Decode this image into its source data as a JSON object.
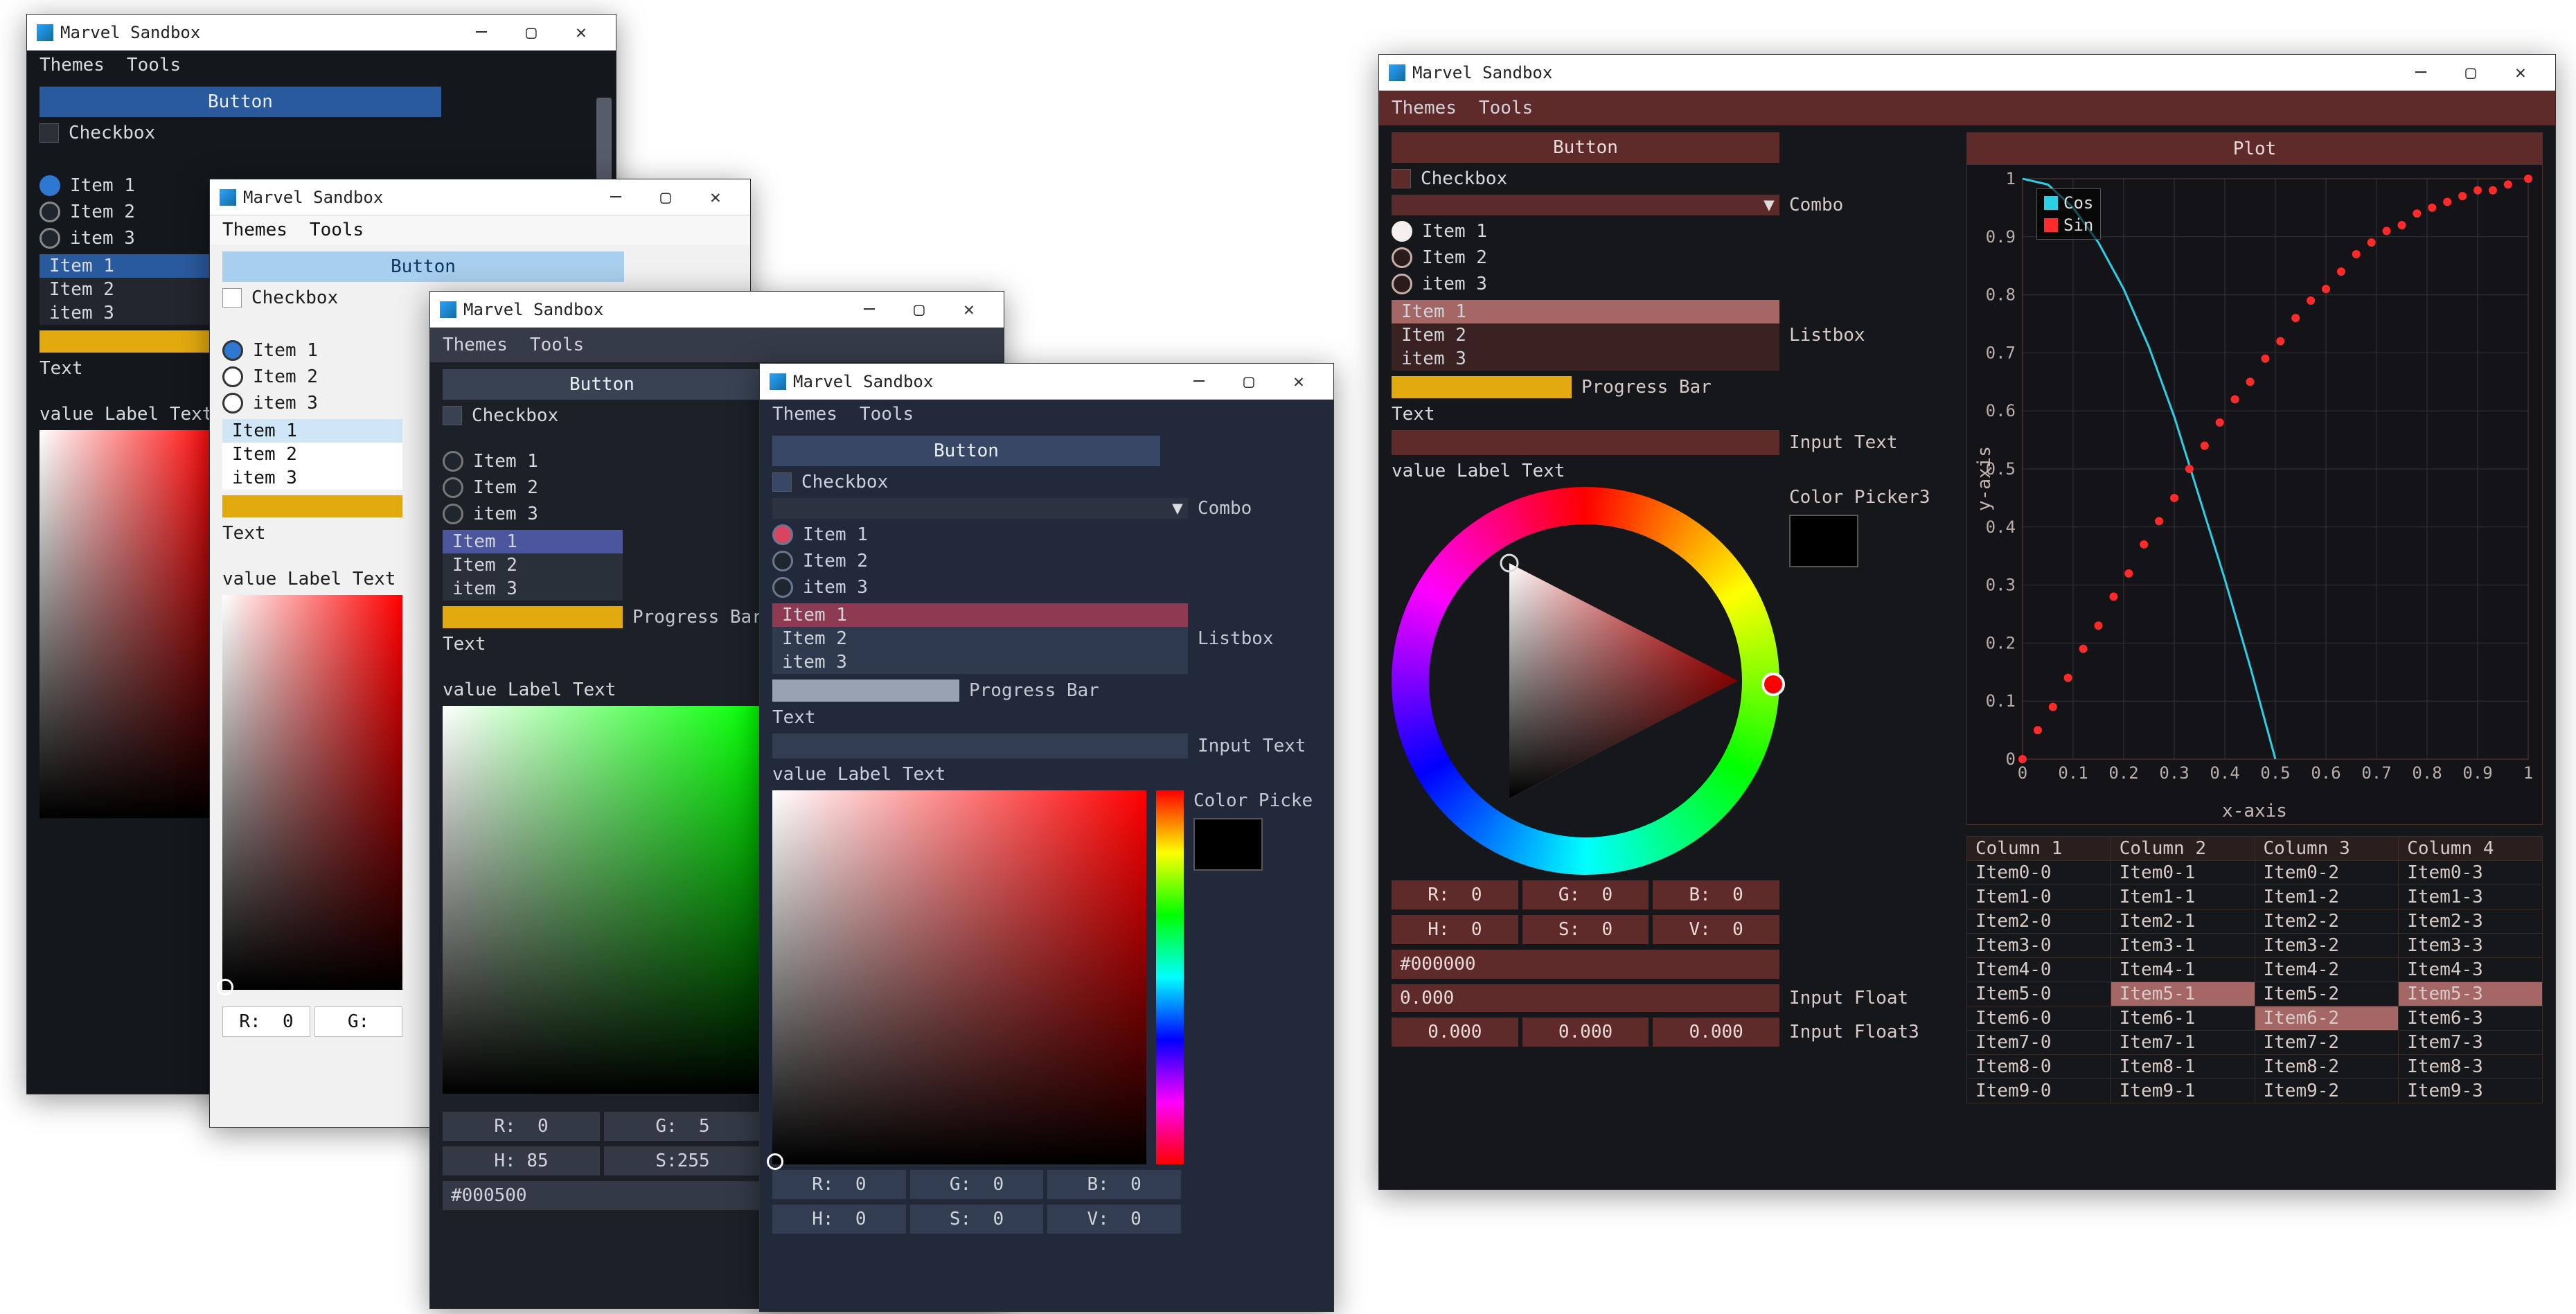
{
  "app_title": "Marvel Sandbox",
  "menus": {
    "themes": "Themes",
    "tools": "Tools"
  },
  "widgets": {
    "button": "Button",
    "checkbox": "Checkbox",
    "radio": [
      "Item 1",
      "Item 2",
      "item 3"
    ],
    "list": [
      "Item 1",
      "Item 2",
      "item 3"
    ],
    "listbox_label": "Listbox",
    "combo_label": "Combo",
    "progress_label": "Progress Bar",
    "progress_value": 0.5,
    "text": "Text",
    "input_text_label": "Input Text",
    "value_label_text": "value Label Text",
    "color_picker3_label": "Color Picker3",
    "color_picker_label": "Color Picke",
    "hex": "#000000",
    "input_float_label": "Input Float",
    "input_float_value": "0.000",
    "input_float3_label": "Input Float3",
    "input_float3_values": [
      "0.000",
      "0.000",
      "0.000"
    ]
  },
  "rgb_labels": {
    "r": "R:",
    "g": "G:",
    "b": "B:",
    "h": "H:",
    "s": "S:",
    "v": "V:"
  },
  "window_a": {
    "rgb": {
      "r": 0,
      "g": null,
      "b": null
    },
    "hsv": {
      "h": null,
      "s": null,
      "v": null
    }
  },
  "window_b": {
    "hex": "#000500",
    "rgb": {
      "r": 0,
      "g": 5,
      "b": null
    },
    "hsv": {
      "h": 85,
      "s": 255,
      "v": null
    }
  },
  "window_c": {
    "rgb": {
      "r": 0,
      "g": 0,
      "b": 0
    },
    "hsv": {
      "h": 0,
      "s": 0,
      "v": 0
    }
  },
  "window_d": {
    "rgb": {
      "r": 0,
      "g": 0,
      "b": 0
    },
    "hsv": {
      "h": 0,
      "s": 0,
      "v": 0
    }
  },
  "chart_data": {
    "type": "line",
    "title": "Plot",
    "xlabel": "x-axis",
    "ylabel": "y-axis",
    "xlim": [
      0,
      1
    ],
    "ylim": [
      0,
      1
    ],
    "xticks": [
      0,
      0.1,
      0.2,
      0.3,
      0.4,
      0.5,
      0.6,
      0.7,
      0.8,
      0.9,
      1
    ],
    "yticks": [
      0,
      0.1,
      0.2,
      0.3,
      0.4,
      0.5,
      0.6,
      0.7,
      0.8,
      0.9,
      1
    ],
    "legend_pos": "upper-left",
    "series": [
      {
        "name": "Cos",
        "color": "#2bd0e6",
        "style": "line",
        "x": [
          0,
          0.05,
          0.1,
          0.15,
          0.2,
          0.25,
          0.3,
          0.35,
          0.4,
          0.45,
          0.5
        ],
        "y": [
          1.0,
          0.99,
          0.95,
          0.89,
          0.81,
          0.71,
          0.59,
          0.45,
          0.31,
          0.16,
          0.0
        ]
      },
      {
        "name": "Sin",
        "color": "#ff2a2a",
        "style": "dots",
        "x": [
          0,
          0.03,
          0.06,
          0.09,
          0.12,
          0.15,
          0.18,
          0.21,
          0.24,
          0.27,
          0.3,
          0.33,
          0.36,
          0.39,
          0.42,
          0.45,
          0.48,
          0.51,
          0.54,
          0.57,
          0.6,
          0.63,
          0.66,
          0.69,
          0.72,
          0.75,
          0.78,
          0.81,
          0.84,
          0.87,
          0.9,
          0.93,
          0.96,
          1.0
        ],
        "y": [
          0.0,
          0.05,
          0.09,
          0.14,
          0.19,
          0.23,
          0.28,
          0.32,
          0.37,
          0.41,
          0.45,
          0.5,
          0.54,
          0.58,
          0.62,
          0.65,
          0.69,
          0.72,
          0.76,
          0.79,
          0.81,
          0.84,
          0.87,
          0.89,
          0.91,
          0.92,
          0.94,
          0.95,
          0.96,
          0.97,
          0.98,
          0.98,
          0.99,
          1.0
        ]
      }
    ]
  },
  "table": {
    "columns": [
      "Column 1",
      "Column 2",
      "Column 3",
      "Column 4"
    ],
    "rows": [
      [
        "Item0-0",
        "Item0-1",
        "Item0-2",
        "Item0-3"
      ],
      [
        "Item1-0",
        "Item1-1",
        "Item1-2",
        "Item1-3"
      ],
      [
        "Item2-0",
        "Item2-1",
        "Item2-2",
        "Item2-3"
      ],
      [
        "Item3-0",
        "Item3-1",
        "Item3-2",
        "Item3-3"
      ],
      [
        "Item4-0",
        "Item4-1",
        "Item4-2",
        "Item4-3"
      ],
      [
        "Item5-0",
        "Item5-1",
        "Item5-2",
        "Item5-3"
      ],
      [
        "Item6-0",
        "Item6-1",
        "Item6-2",
        "Item6-3"
      ],
      [
        "Item7-0",
        "Item7-1",
        "Item7-2",
        "Item7-3"
      ],
      [
        "Item8-0",
        "Item8-1",
        "Item8-2",
        "Item8-3"
      ],
      [
        "Item9-0",
        "Item9-1",
        "Item9-2",
        "Item9-3"
      ]
    ],
    "selected_cells": [
      [
        5,
        1
      ],
      [
        5,
        3
      ],
      [
        6,
        2
      ]
    ]
  }
}
